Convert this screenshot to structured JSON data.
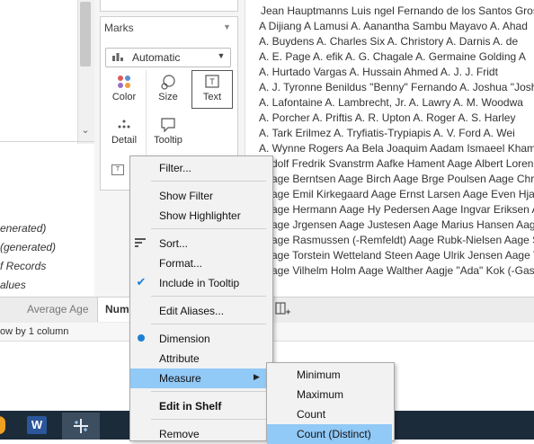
{
  "side_pane": {
    "fields": [
      "enerated)",
      "(generated)",
      "f Records",
      "alues"
    ]
  },
  "marks_card": {
    "title": "Marks",
    "mark_type": "Automatic",
    "buttons": [
      {
        "label": "Color",
        "icon": "color-icon"
      },
      {
        "label": "Size",
        "icon": "size-icon"
      },
      {
        "label": "Text",
        "icon": "text-icon",
        "selected": true
      },
      {
        "label": "Detail",
        "icon": "detail-icon"
      },
      {
        "label": "Tooltip",
        "icon": "tooltip-icon"
      }
    ]
  },
  "view": {
    "rows": [
      "Jean Hauptmanns    Luis ngel Fernando de los Santos Grossi",
      "A Dijiang   A Lamusi   A. Aanantha Sambu Mayavo   A. Ahad",
      "A. Buydens   A. Charles Six   A. Christory   A. Darnis   A. de",
      "A. E. Page   A. efik   A. G. Chagale   A. Germaine Golding   A",
      "A. Hurtado Vargas   A. Hussain Ahmed   A. J. J. Fridt",
      "A. J. Tyronne Benildus \"Benny\" Fernando   A. Joshua \"Josh\"",
      "A. Lafontaine   A. Lambrecht, Jr.   A. Lawry   A. M. Woodwa",
      "A. Porcher   A. Priftis   A. R. Upton   A. Roger   A. S. Harley",
      "A. Tark Erilmez   A. Tryfiatis-Trypiapis   A. V. Ford   A. Wei",
      "A. Wynne Rogers   Aa Bela Joaquim   Aadam Ismaeel Khama",
      "dolf Fredrik Svanstrm   Aafke Hament   Aage Albert Lorenz",
      "age Berntsen   Aage Birch   Aage Brge Poulsen   Aage Chri",
      "age Emil Kirkegaard   Aage Ernst Larsen   Aage Even Hjalm",
      "age Hermann   Aage Hy Pedersen   Aage Ingvar Eriksen   A",
      "age Jrgensen   Aage Justesen   Aage Marius Hansen   Aag",
      "age Rasmussen (-Remfeldt)   Aage Rubk-Nielsen   Aage So",
      "age Torstein Wetteland Steen   Aage Ulrik Jensen   Aage V",
      "age Vilhelm Holm   Aage Walther   Aagje \"Ada\" Kok (-Gastel"
    ]
  },
  "tabs": {
    "average_age": "Average Age",
    "active": "Num"
  },
  "status_bar": {
    "text": "ow by 1 column"
  },
  "taskbar": {
    "word_label": "W"
  },
  "context_menu": {
    "items": [
      {
        "label": "Filter..."
      },
      {
        "label": "Show Filter"
      },
      {
        "label": "Show Highlighter"
      },
      {
        "label": "Sort..."
      },
      {
        "label": "Format..."
      },
      {
        "label": "Include in Tooltip",
        "checked": true
      },
      {
        "label": "Edit Aliases..."
      },
      {
        "label": "Dimension",
        "selected": true
      },
      {
        "label": "Attribute"
      },
      {
        "label": "Measure",
        "highlighted": true,
        "has_submenu": true
      },
      {
        "label": "Edit in Shelf"
      },
      {
        "label": "Remove"
      }
    ]
  },
  "measure_submenu": {
    "items": [
      {
        "label": "Minimum"
      },
      {
        "label": "Maximum"
      },
      {
        "label": "Count"
      },
      {
        "label": "Count (Distinct)",
        "highlighted": true
      }
    ]
  },
  "colors": {
    "menu_highlight": "#91c9f7",
    "check_blue": "#1e7fd3",
    "taskbar": "#1c2b3a",
    "word_blue": "#2b579a"
  }
}
